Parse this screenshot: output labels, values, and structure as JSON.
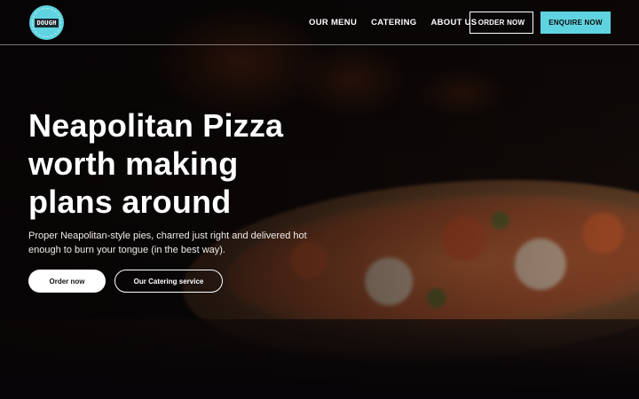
{
  "brand": {
    "logo_text": "DOUGH",
    "logo_color": "#5fd4e0"
  },
  "nav": {
    "items": [
      {
        "label": "OUR MENU"
      },
      {
        "label": "CATERING"
      },
      {
        "label": "ABOUT US"
      }
    ],
    "order_button": "ORDER NOW",
    "enquire_button": "ENQUIRE NOW"
  },
  "hero": {
    "headline_lines": [
      "Neapolitan Pizza",
      "worth making",
      "plans around"
    ],
    "subtext": "Proper Neapolitan-style pies, charred just right and delivered hot enough to burn your tongue (in the best way).",
    "primary_cta": "Order now",
    "secondary_cta": "Our Catering service",
    "background_image": "pizza-photo"
  },
  "colors": {
    "accent": "#5fd4e0",
    "text": "#ffffff",
    "background": "#0a0707"
  }
}
